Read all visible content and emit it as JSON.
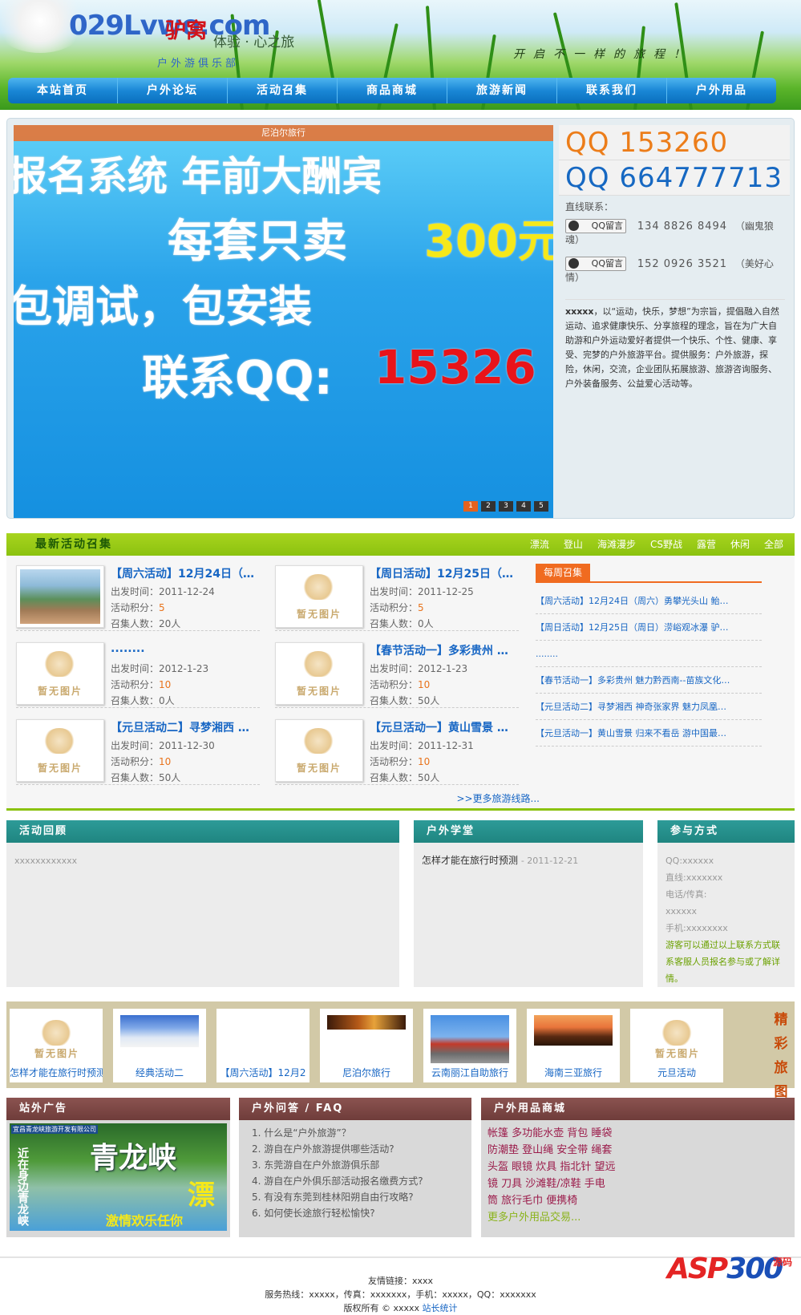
{
  "header": {
    "logo_main": "029Lvwo.com",
    "logo_cn": "驴窝",
    "logo_slogan": "体验 · 心之旅",
    "logo_sub": "户外游俱乐部",
    "tagline": "开启不一样的旅程！"
  },
  "nav": [
    "本站首页",
    "户外论坛",
    "活动召集",
    "商品商城",
    "旅游新闻",
    "联系我们",
    "户外用品"
  ],
  "banner": {
    "caption": "尼泊尔旅行",
    "lines": [
      "报名系统 年前大酬宾",
      "每套只卖",
      "300元",
      "包调试，包安装",
      "联系QQ:",
      "15326"
    ],
    "dots": [
      "1",
      "2",
      "3",
      "4",
      "5"
    ]
  },
  "contact": {
    "qq1": "QQ 153260",
    "qq2": "QQ 664777713",
    "direct_label": "直线联系：",
    "qq_button": "QQ留言",
    "phone1": "134 8826 8494",
    "name1": "（幽鬼狼魂）",
    "phone2": "152 0926 3521",
    "name2": "（美好心情）",
    "intro_bold": "xxxxx",
    "intro": "，以“运动，快乐，梦想”为宗旨，提倡融入自然运动、追求健康快乐、分享旅程的理念，旨在为广大自助游和户外运动爱好者提供一个快乐、个性、健康、享受、完梦的户外旅游平台。提供服务：户外旅游，探险，休闲，交流，企业团队拓展旅游、旅游咨询服务、户外装备服务、公益爱心活动等。"
  },
  "activities": {
    "title": "最新活动召集",
    "links": [
      "漂流",
      "登山",
      "海滩漫步",
      "CS野战",
      "露营",
      "休闲",
      "全部"
    ],
    "depart_label": "出发时间：",
    "points_label": "活动积分：",
    "people_label": "召集人数：",
    "items": [
      {
        "title": "【周六活动】12月24日（…",
        "date": "2011-12-24",
        "points": "5",
        "people": "20人"
      },
      {
        "title": "【周日活动】12月25日（…",
        "date": "2011-12-25",
        "points": "5",
        "people": "0人"
      },
      {
        "title": "........",
        "date": "2012-1-23",
        "points": "10",
        "people": "0人"
      },
      {
        "title": "【春节活动一】多彩贵州 …",
        "date": "2012-1-23",
        "points": "10",
        "people": "50人"
      },
      {
        "title": "【元旦活动二】寻梦湘西 …",
        "date": "2011-12-30",
        "points": "10",
        "people": "50人"
      },
      {
        "title": "【元旦活动一】黄山雪景 …",
        "date": "2011-12-31",
        "points": "10",
        "people": "50人"
      }
    ],
    "more": ">>更多旅游线路..."
  },
  "weekly": {
    "tab": "每周召集",
    "items": [
      "【周六活动】12月24日（周六）勇攀光头山 鲐…",
      "【周日活动】12月25日（周日）涝峪观冰瀑 驴…",
      "........",
      "【春节活动一】多彩贵州 魅力黔西南--苗族文化…",
      "【元旦活动二】寻梦湘西 神奇张家界 魅力凤凰…",
      "【元旦活动一】黄山雪景 归来不看岳 游中国最…"
    ]
  },
  "review": {
    "title": "活动回顾",
    "content": "xxxxxxxxxxxx"
  },
  "school": {
    "title": "户外学堂",
    "item": "怎样才能在旅行时预测",
    "date": "- 2011-12-21"
  },
  "join": {
    "title": "参与方式",
    "qq": "QQ:xxxxxx",
    "line": "直线:xxxxxxx",
    "phone": "电话/传真:",
    "phone_val": "xxxxxx",
    "mobile": "手机:xxxxxxxx",
    "note": "游客可以通过以上联系方式联系客服人员报名参与或了解详情。"
  },
  "gallery": {
    "items": [
      "怎样才能在旅行时预测",
      "经典活动二",
      "【周六活动】12月2",
      "尼泊尔旅行",
      "云南丽江自助旅行",
      "海南三亚旅行",
      "元旦活动"
    ],
    "side": [
      "精",
      "彩",
      "旅",
      "图"
    ]
  },
  "ads": {
    "title": "站外广告",
    "ad_company": "宜昌青龙峡旅游开发有限公司",
    "ad_big": "青龙峡",
    "ad_big2": "漂",
    "ad_line": "激情欢乐任你",
    "ad_sub": "近在身边青龙峡"
  },
  "faq": {
    "title": "户外问答 / FAQ",
    "items": [
      "1.  什么是“户外旅游”？",
      "2.  游自在户外旅游提供哪些活动?",
      "3.  东莞游自在户外旅游俱乐部",
      "4.  游自在户外俱乐部活动报名缴费方式?",
      "5.  有没有东莞到桂林阳朔自由行攻略?",
      "6.  如何使长途旅行轻松愉快?"
    ]
  },
  "shop": {
    "title": "户外用品商城",
    "lines": [
      "帐篷  多功能水壶  背包  睡袋",
      "防潮垫  登山绳  安全带  绳套",
      "头盔  眼镜  炊具  指北针  望远",
      "镜  刀具  沙滩鞋/凉鞋  手电",
      "筒  旅行毛巾  便携椅"
    ],
    "more": "更多户外用品交易..."
  },
  "footer": {
    "links": "友情链接：xxxx",
    "service": "服务热线：xxxxx，传真：xxxxxxx，手机：xxxxx，QQ：xxxxxxx",
    "copyright": "版权所有 © xxxxx",
    "stats": "站长统计"
  },
  "watermark": {
    "asp": "ASP",
    "num": "300",
    "cn1": "源码",
    "cn2": ""
  }
}
